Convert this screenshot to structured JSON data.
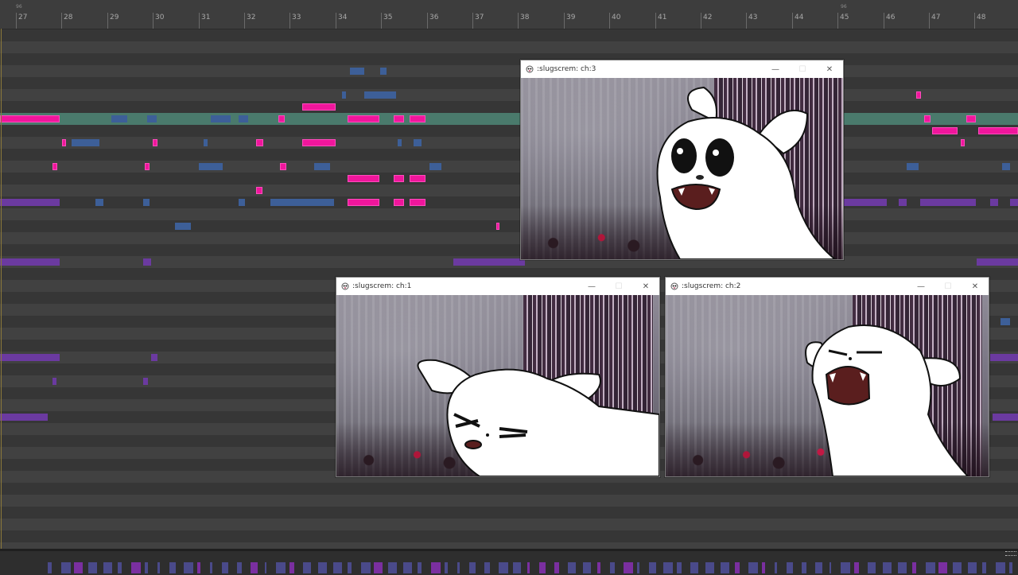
{
  "timeline": {
    "ruler_labels": [
      "27",
      "28",
      "29",
      "30",
      "31",
      "32",
      "33",
      "34",
      "35",
      "36",
      "37",
      "38",
      "39",
      "40",
      "41",
      "42",
      "43",
      "44",
      "45",
      "46",
      "47",
      "48"
    ],
    "marker_labels": [
      "96",
      "96"
    ]
  },
  "windows": [
    {
      "id": "ch3",
      "title": ":slugscrem: ch:3",
      "minimize": "—",
      "maximize": "☐",
      "close": "✕"
    },
    {
      "id": "ch1",
      "title": ":slugscrem: ch:1",
      "minimize": "—",
      "maximize": "☐",
      "close": "✕"
    },
    {
      "id": "ch2",
      "title": ":slugscrem: ch:2",
      "minimize": "—",
      "maximize": "☐",
      "close": "✕"
    }
  ],
  "colors": {
    "note_pink": "#f0169c",
    "note_blue": "#3d5f98",
    "note_purple": "#6b3aa0",
    "selected_lane": "#4a7a6c",
    "background": "#3a3a3a"
  },
  "icons": [
    "app-icon",
    "minimize-icon",
    "maximize-icon",
    "close-icon",
    "playhead",
    "scrollbar-grip"
  ]
}
